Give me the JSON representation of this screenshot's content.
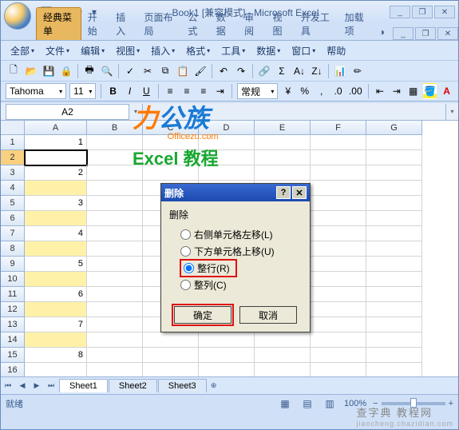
{
  "title": "Book1 [兼容模式] - Microsoft Excel",
  "ribbon_tabs": [
    "经典菜单",
    "开始",
    "插入",
    "页面布局",
    "公式",
    "数据",
    "审阅",
    "视图",
    "开发工具",
    "加载项"
  ],
  "menus": {
    "all": "全部",
    "file": "文件",
    "edit": "编辑",
    "view": "视图",
    "insert": "插入",
    "format": "格式",
    "tools": "工具",
    "data": "数据",
    "window": "窗口",
    "help": "帮助"
  },
  "font": {
    "name": "Tahoma",
    "size": "11",
    "style_label": "常规"
  },
  "namebox": "A2",
  "watermark": {
    "brand_prefix": "力",
    "brand_suffix": "公族",
    "url": "Officezu.com",
    "tagline": "Excel 教程"
  },
  "columns": [
    "A",
    "B",
    "C",
    "D",
    "E",
    "F",
    "G"
  ],
  "rows": [
    {
      "n": 1,
      "a": "1"
    },
    {
      "n": 2,
      "a": ""
    },
    {
      "n": 3,
      "a": "2"
    },
    {
      "n": 4,
      "a": ""
    },
    {
      "n": 5,
      "a": "3"
    },
    {
      "n": 6,
      "a": ""
    },
    {
      "n": 7,
      "a": "4"
    },
    {
      "n": 8,
      "a": ""
    },
    {
      "n": 9,
      "a": "5"
    },
    {
      "n": 10,
      "a": ""
    },
    {
      "n": 11,
      "a": "6"
    },
    {
      "n": 12,
      "a": ""
    },
    {
      "n": 13,
      "a": "7"
    },
    {
      "n": 14,
      "a": ""
    },
    {
      "n": 15,
      "a": "8"
    },
    {
      "n": 16,
      "a": ""
    }
  ],
  "sheets": [
    "Sheet1",
    "Sheet2",
    "Sheet3"
  ],
  "status": {
    "ready": "就绪",
    "zoom": "100%",
    "zoom_minus": "−",
    "zoom_plus": "+"
  },
  "dialog": {
    "title": "删除",
    "group": "删除",
    "opt_shift_left": "右侧单元格左移(L)",
    "opt_shift_up": "下方单元格上移(U)",
    "opt_row": "整行(R)",
    "opt_col": "整列(C)",
    "ok": "确定",
    "cancel": "取消"
  },
  "corner_wm": {
    "main": "查字典 教程网",
    "sub": "jiaocheng.chazidian.com"
  }
}
